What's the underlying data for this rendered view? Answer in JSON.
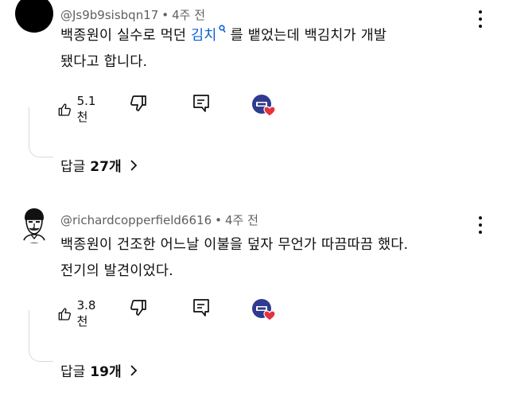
{
  "comments": [
    {
      "username": "@Js9b9sisbqn17",
      "time": "4주 전",
      "text_before": "백종원이 실수로 먹던 ",
      "text_link": "김치",
      "text_after_line1": "를 뱉었는데 백김치가 개발",
      "text_line2": "됐다고 합니다.",
      "likes": "5.1천",
      "reply_prefix": "답글",
      "reply_count": "27개"
    },
    {
      "username": "@richardcopperfield6616",
      "time": "4주 전",
      "text_line1": "백종원이 건조한 어느날 이불을 덮자 무언가 따끔따끔 했다.",
      "text_line2": "전기의 발견이었다.",
      "likes": "3.8천",
      "reply_prefix": "답글",
      "reply_count": "19개"
    }
  ],
  "separator": "•",
  "icons": {
    "like": "thumbs-up-icon",
    "dislike": "thumbs-down-icon",
    "reply": "reply-icon",
    "more": "more-vert-icon",
    "heart": "creator-heart-icon",
    "chevron": "chevron-right-icon",
    "search": "search-icon"
  },
  "colors": {
    "link": "#065fd4",
    "heart": "#e7313d",
    "creator_badge": "#2f3b8f",
    "meta": "#606060"
  }
}
